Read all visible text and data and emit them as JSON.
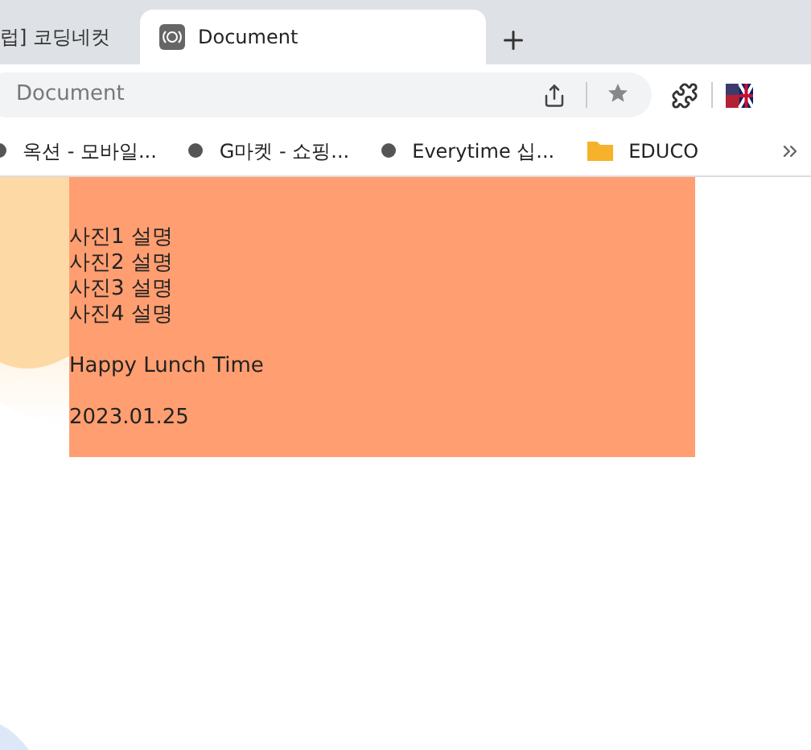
{
  "tabs": [
    {
      "title": "럽] 코딩네컷",
      "selected": false
    },
    {
      "title": "Document",
      "selected": true
    }
  ],
  "address_bar": {
    "value": "Document"
  },
  "bookmarks": [
    {
      "kind": "site",
      "label": "옥션 - 모바일..."
    },
    {
      "kind": "site",
      "label": "G마켓 - 쇼핑..."
    },
    {
      "kind": "site",
      "label": "Everytime 십..."
    },
    {
      "kind": "folder",
      "label": "EDUCO"
    }
  ],
  "content": {
    "captions": [
      "사진1 설명",
      "사진2 설명",
      "사진3 설명",
      "사진4 설명"
    ],
    "title": "Happy Lunch Time",
    "date": "2023.01.25"
  }
}
